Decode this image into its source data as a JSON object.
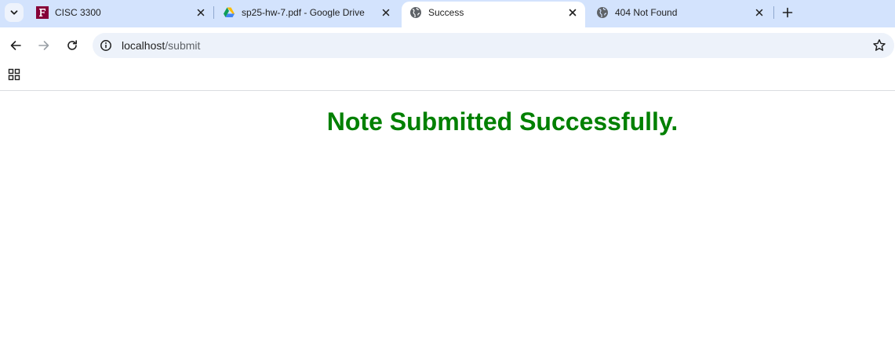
{
  "tabs": [
    {
      "title": "CISC 3300",
      "favicon": "fordham-f-icon",
      "active": false
    },
    {
      "title": "sp25-hw-7.pdf - Google Drive",
      "favicon": "google-drive-icon",
      "active": false
    },
    {
      "title": "Success",
      "favicon": "globe-icon",
      "active": true
    },
    {
      "title": "404 Not Found",
      "favicon": "globe-icon",
      "active": false
    }
  ],
  "toolbar": {
    "url_host": "localhost",
    "url_path": "/submit"
  },
  "page": {
    "heading": "Note Submitted Successfully.",
    "heading_color": "#008000"
  },
  "colors": {
    "tabstrip_bg": "#d3e3fd",
    "omnibox_bg": "#edf2fa"
  }
}
